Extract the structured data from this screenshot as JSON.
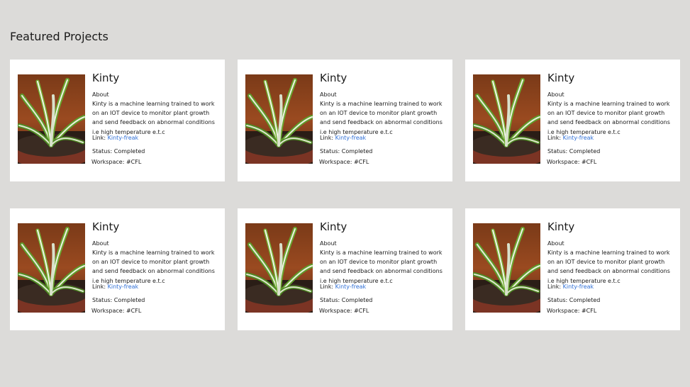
{
  "section": {
    "title": "Featured Projects"
  },
  "projects": [
    {
      "title": "Kinty",
      "about_label": "About",
      "description": "Kinty is a machine learning trained to work on an IOT device to monitor plant growth and send feedback on abnormal conditions i.e high temperature e.t.c",
      "link_label": "Link:",
      "link_text": "Kinty-freak",
      "status": "Status: Completed",
      "workspace": "Workspace: #CFL"
    },
    {
      "title": "Kinty",
      "about_label": "About",
      "description": "Kinty is a machine learning trained to work on an IOT device to monitor plant growth and send feedback on abnormal conditions i.e high temperature e.t.c",
      "link_label": "Link:",
      "link_text": "Kinty-freak",
      "status": "Status: Completed",
      "workspace": "Workspace: #CFL"
    },
    {
      "title": "Kinty",
      "about_label": "About",
      "description": "Kinty is a machine learning trained to work on an IOT device to monitor plant growth and send feedback on abnormal conditions i.e high temperature e.t.c",
      "link_label": "Link:",
      "link_text": "Kinty-freak",
      "status": "Status: Completed",
      "workspace": "Workspace: #CFL"
    },
    {
      "title": "Kinty",
      "about_label": "About",
      "description": "Kinty is a machine learning trained to work on an IOT device to monitor plant growth and send feedback on abnormal conditions i.e high temperature e.t.c",
      "link_label": "Link:",
      "link_text": "Kinty-freak",
      "status": "Status: Completed",
      "workspace": "Workspace: #CFL"
    },
    {
      "title": "Kinty",
      "about_label": "About",
      "description": "Kinty is a machine learning trained to work on an IOT device to monitor plant growth and send feedback on abnormal conditions i.e high temperature e.t.c",
      "link_label": "Link:",
      "link_text": "Kinty-freak",
      "status": "Status: Completed",
      "workspace": "Workspace: #CFL"
    },
    {
      "title": "Kinty",
      "about_label": "About",
      "description": "Kinty is a machine learning trained to work on an IOT device to monitor plant growth and send feedback on abnormal conditions i.e high temperature e.t.c",
      "link_label": "Link:",
      "link_text": "Kinty-freak",
      "status": "Status: Completed",
      "workspace": "Workspace: #CFL"
    }
  ],
  "colors": {
    "page_background": "#dcdbd9",
    "card_background": "#ffffff",
    "link": "#2f6fd6"
  },
  "icons": {
    "project_thumbnail": "spider-plant-photo"
  }
}
